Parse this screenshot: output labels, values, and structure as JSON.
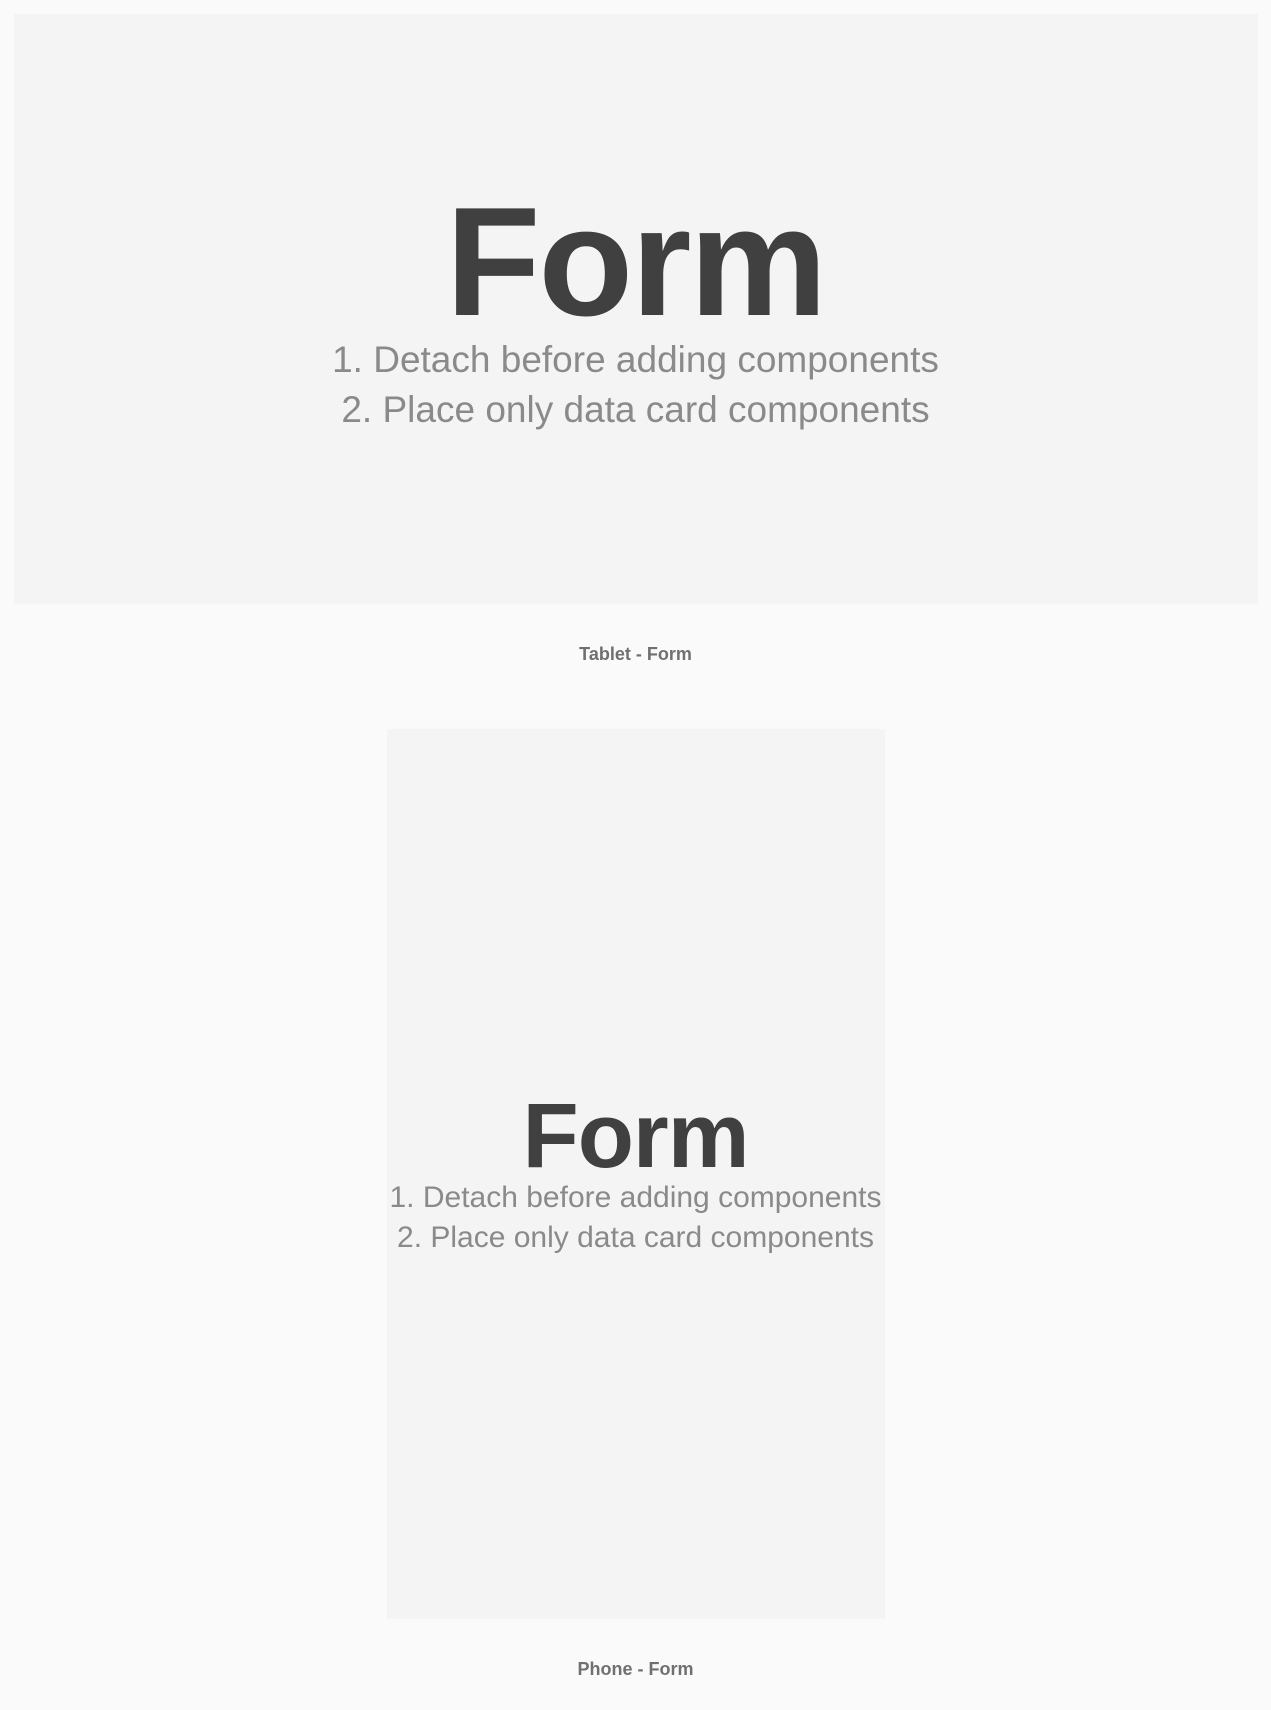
{
  "tablet": {
    "title": "Form",
    "instruction1": "1. Detach before adding components",
    "instruction2": "2. Place only data card components",
    "caption": "Tablet - Form"
  },
  "phone": {
    "title": "Form",
    "instruction1": "1. Detach before adding components",
    "instruction2": "2. Place only data card components",
    "caption": "Phone - Form"
  }
}
